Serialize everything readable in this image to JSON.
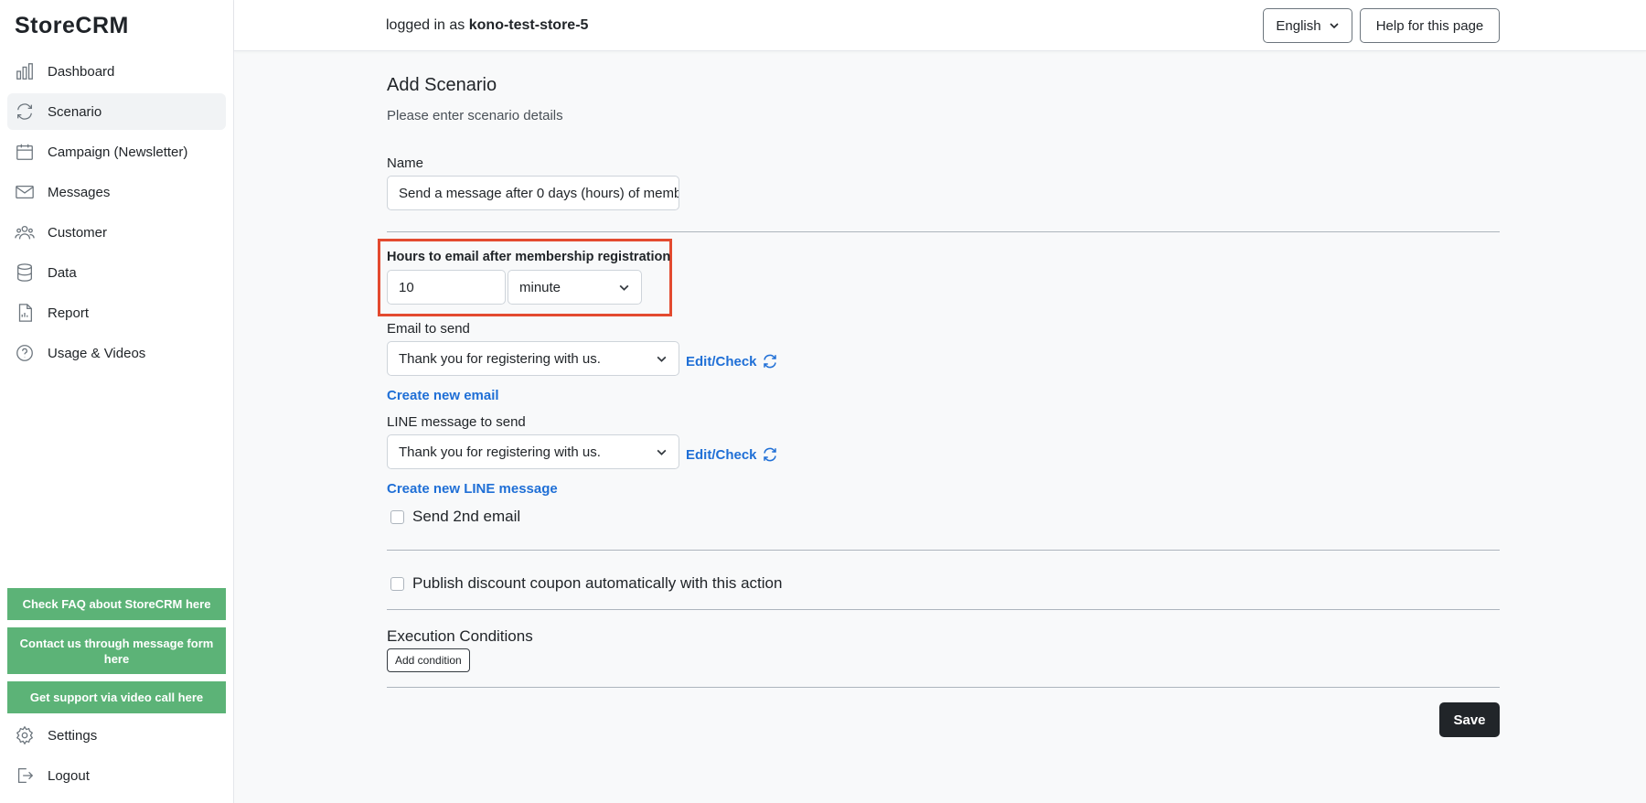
{
  "app": {
    "logo": "StoreCRM"
  },
  "sidebar": {
    "items": [
      {
        "label": "Dashboard",
        "icon": "bar-chart-icon",
        "active": false
      },
      {
        "label": "Scenario",
        "icon": "sync-icon",
        "active": true
      },
      {
        "label": "Campaign (Newsletter)",
        "icon": "calendar-icon",
        "active": false
      },
      {
        "label": "Messages",
        "icon": "envelope-icon",
        "active": false
      },
      {
        "label": "Customer",
        "icon": "people-icon",
        "active": false
      },
      {
        "label": "Data",
        "icon": "database-icon",
        "active": false
      },
      {
        "label": "Report",
        "icon": "document-icon",
        "active": false
      },
      {
        "label": "Usage & Videos",
        "icon": "question-circle-icon",
        "active": false
      }
    ],
    "help_buttons": [
      "Check FAQ about StoreCRM here",
      "Contact us through message form here",
      "Get support via video call here"
    ],
    "settings_label": "Settings",
    "logout_label": "Logout"
  },
  "header": {
    "logged_in_prefix": "logged in as",
    "username": "kono-test-store-5",
    "language": "English",
    "help_label": "Help for this page"
  },
  "form": {
    "title": "Add Scenario",
    "subtitle": "Please enter scenario details",
    "name_label": "Name",
    "name_value": "Send a message after 0 days (hours) of memb",
    "hours_label": "Hours to email after membership registration",
    "hours_value": "10",
    "unit_value": "minute",
    "email_label": "Email to send",
    "email_value": "Thank you for registering with us.",
    "edit_check": "Edit/Check",
    "create_email": "Create new email",
    "line_label": "LINE message to send",
    "line_value": "Thank you for registering with us.",
    "create_line": "Create new LINE message",
    "second_email_label": "Send 2nd email",
    "coupon_label": "Publish discount coupon automatically with this action",
    "conditions_title": "Execution Conditions",
    "add_condition": "Add condition",
    "save": "Save"
  },
  "colors": {
    "help_green": "#5cb377",
    "link_blue": "#1f6fd6",
    "highlight_red": "#e34a2f",
    "save_dark": "#212529"
  }
}
